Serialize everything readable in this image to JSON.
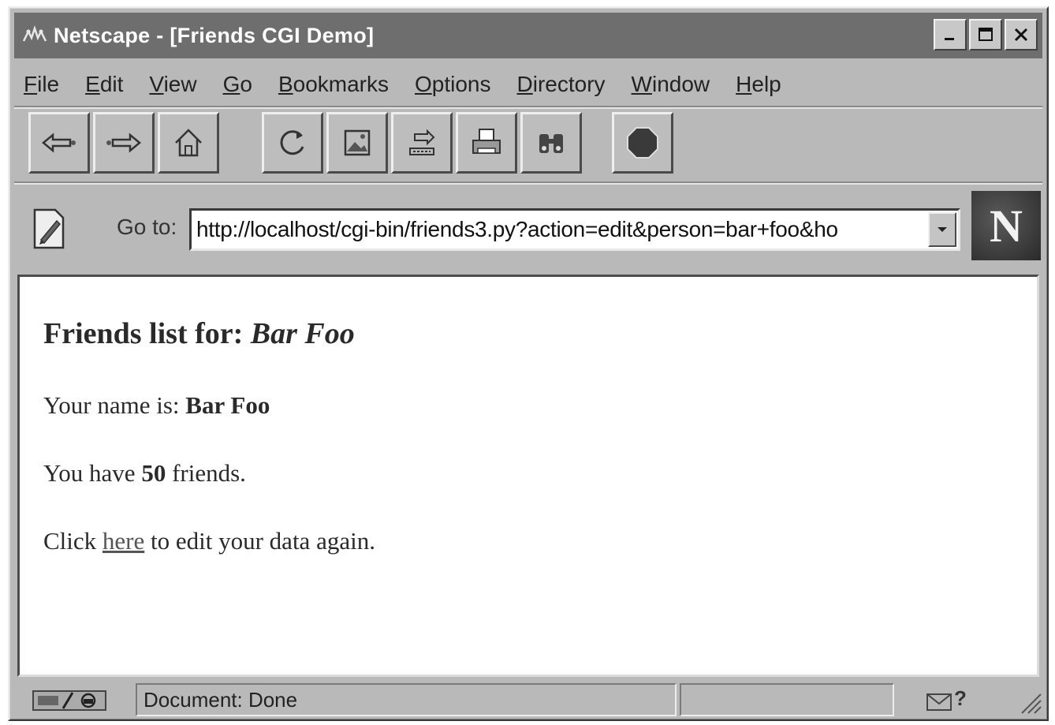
{
  "window": {
    "title": "Netscape - [Friends CGI Demo]",
    "controls": [
      "minimize",
      "maximize",
      "close"
    ]
  },
  "menu": {
    "items": [
      {
        "label": "File",
        "accel": "F"
      },
      {
        "label": "Edit",
        "accel": "E"
      },
      {
        "label": "View",
        "accel": "V"
      },
      {
        "label": "Go",
        "accel": "G"
      },
      {
        "label": "Bookmarks",
        "accel": "B"
      },
      {
        "label": "Options",
        "accel": "O"
      },
      {
        "label": "Directory",
        "accel": "D"
      },
      {
        "label": "Window",
        "accel": "W"
      },
      {
        "label": "Help",
        "accel": "H"
      }
    ]
  },
  "toolbar": {
    "buttons": [
      "back-icon",
      "forward-icon",
      "home-icon",
      "reload-icon",
      "images-icon",
      "open-icon",
      "print-icon",
      "find-icon",
      "stop-icon"
    ]
  },
  "location": {
    "label": "Go to:",
    "url": "http://localhost/cgi-bin/friends3.py?action=edit&person=bar+foo&ho"
  },
  "page": {
    "heading_prefix": "Friends list for: ",
    "heading_name": "Bar Foo",
    "name_prefix": "Your name is: ",
    "name_value": "Bar Foo",
    "friends_prefix": "You have ",
    "friends_count": "50",
    "friends_suffix": " friends.",
    "edit_prefix": "Click ",
    "edit_link": "here",
    "edit_suffix": " to edit your data again."
  },
  "status": {
    "text": "Document: Done"
  },
  "colors": {
    "titlebar": "#6e6e6e",
    "chrome": "#b9b9b9",
    "content_bg": "#ffffff"
  }
}
